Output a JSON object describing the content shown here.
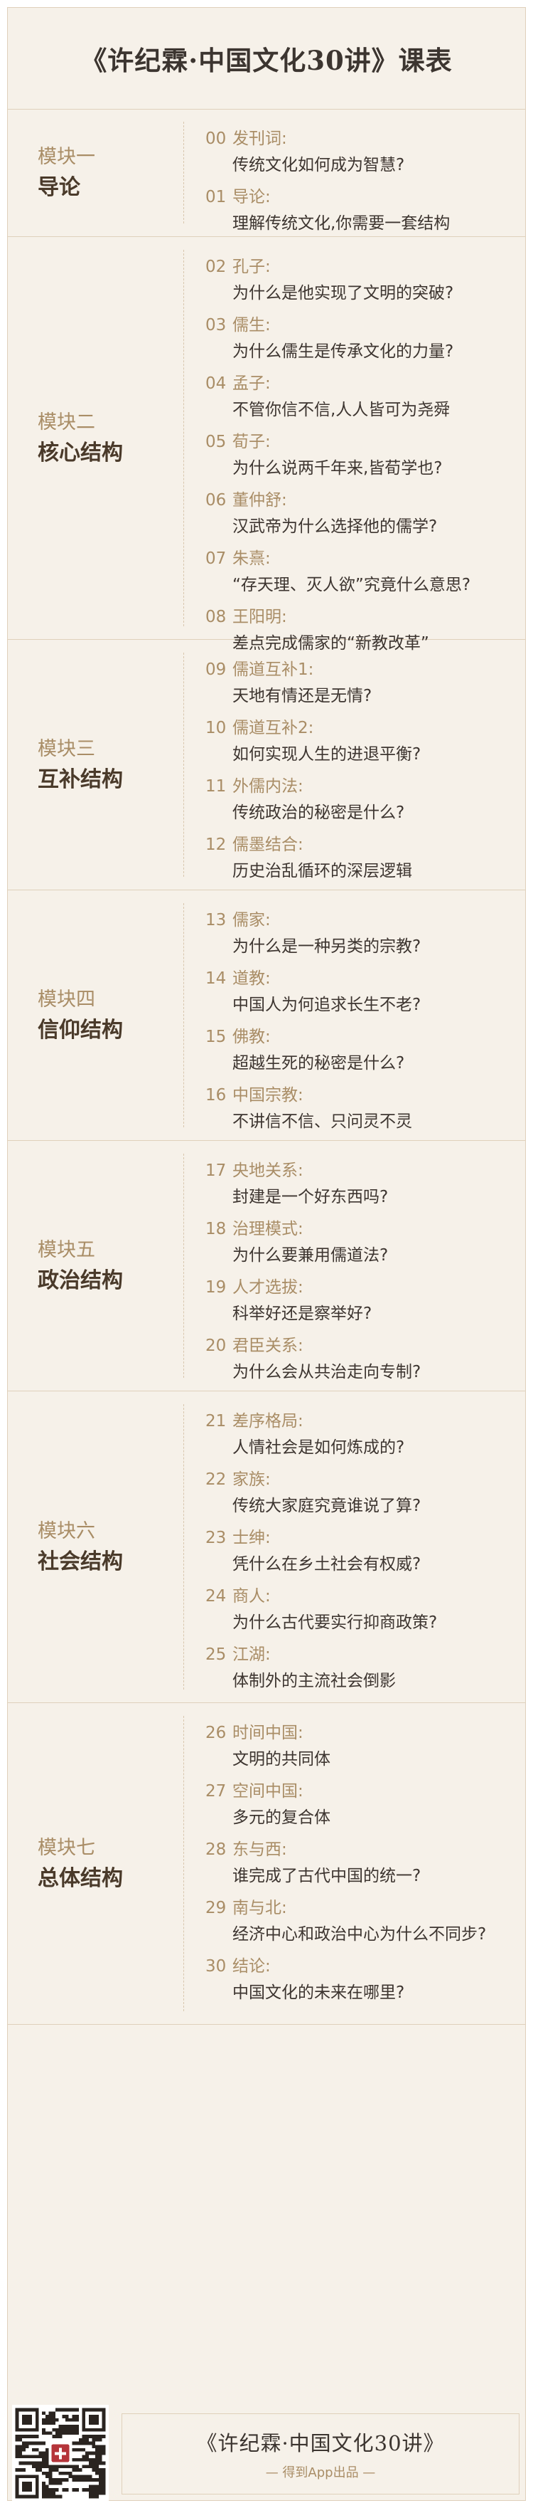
{
  "header": {
    "title": "《许纪霖·中国文化30讲》课表"
  },
  "modules": [
    {
      "index": "模块一",
      "name": "导论",
      "lectures": [
        {
          "num": "00",
          "tag": "发刊词:",
          "title": "传统文化如何成为智慧?"
        },
        {
          "num": "01",
          "tag": "导论:",
          "title": "理解传统文化,你需要一套结构"
        }
      ]
    },
    {
      "index": "模块二",
      "name": "核心结构",
      "lectures": [
        {
          "num": "02",
          "tag": "孔子:",
          "title": "为什么是他实现了文明的突破?"
        },
        {
          "num": "03",
          "tag": "儒生:",
          "title": "为什么儒生是传承文化的力量?"
        },
        {
          "num": "04",
          "tag": "孟子:",
          "title": "不管你信不信,人人皆可为尧舜"
        },
        {
          "num": "05",
          "tag": "荀子:",
          "title": "为什么说两千年来,皆荀学也?"
        },
        {
          "num": "06",
          "tag": "董仲舒:",
          "title": "汉武帝为什么选择他的儒学?"
        },
        {
          "num": "07",
          "tag": "朱熹:",
          "title": "“存天理、灭人欲”究竟什么意思?"
        },
        {
          "num": "08",
          "tag": "王阳明:",
          "title": "差点完成儒家的“新教改革”"
        }
      ]
    },
    {
      "index": "模块三",
      "name": "互补结构",
      "lectures": [
        {
          "num": "09",
          "tag": "儒道互补1:",
          "title": "天地有情还是无情?"
        },
        {
          "num": "10",
          "tag": "儒道互补2:",
          "title": "如何实现人生的进退平衡?"
        },
        {
          "num": "11",
          "tag": "外儒内法:",
          "title": "传统政治的秘密是什么?"
        },
        {
          "num": "12",
          "tag": "儒墨结合:",
          "title": "历史治乱循环的深层逻辑"
        }
      ]
    },
    {
      "index": "模块四",
      "name": "信仰结构",
      "lectures": [
        {
          "num": "13",
          "tag": "儒家:",
          "title": "为什么是一种另类的宗教?"
        },
        {
          "num": "14",
          "tag": "道教:",
          "title": "中国人为何追求长生不老?"
        },
        {
          "num": "15",
          "tag": "佛教:",
          "title": "超越生死的秘密是什么?"
        },
        {
          "num": "16",
          "tag": "中国宗教:",
          "title": "不讲信不信、只问灵不灵"
        }
      ]
    },
    {
      "index": "模块五",
      "name": "政治结构",
      "lectures": [
        {
          "num": "17",
          "tag": "央地关系:",
          "title": "封建是一个好东西吗?"
        },
        {
          "num": "18",
          "tag": "治理模式:",
          "title": "为什么要兼用儒道法?"
        },
        {
          "num": "19",
          "tag": "人才选拔:",
          "title": "科举好还是察举好?"
        },
        {
          "num": "20",
          "tag": "君臣关系:",
          "title": "为什么会从共治走向专制?"
        }
      ]
    },
    {
      "index": "模块六",
      "name": "社会结构",
      "lectures": [
        {
          "num": "21",
          "tag": "差序格局:",
          "title": "人情社会是如何炼成的?"
        },
        {
          "num": "22",
          "tag": "家族:",
          "title": "传统大家庭究竟谁说了算?"
        },
        {
          "num": "23",
          "tag": "士绅:",
          "title": "凭什么在乡土社会有权威?"
        },
        {
          "num": "24",
          "tag": "商人:",
          "title": "为什么古代要实行抑商政策?"
        },
        {
          "num": "25",
          "tag": "江湖:",
          "title": "体制外的主流社会倒影"
        }
      ]
    },
    {
      "index": "模块七",
      "name": "总体结构",
      "lectures": [
        {
          "num": "26",
          "tag": "时间中国:",
          "title": "文明的共同体"
        },
        {
          "num": "27",
          "tag": "空间中国:",
          "title": "多元的复合体"
        },
        {
          "num": "28",
          "tag": "东与西:",
          "title": "谁完成了古代中国的统一?"
        },
        {
          "num": "29",
          "tag": "南与北:",
          "title": "经济中心和政治中心为什么不同步?"
        },
        {
          "num": "30",
          "tag": "结论:",
          "title": "中国文化的未来在哪里?"
        }
      ]
    }
  ],
  "footer": {
    "title": "《许纪霖·中国文化30讲》",
    "sub": "— 得到App出品 —"
  },
  "colors": {
    "accent": "#a98d66",
    "background": "#f6f1e9",
    "border": "#dfd0bb"
  }
}
